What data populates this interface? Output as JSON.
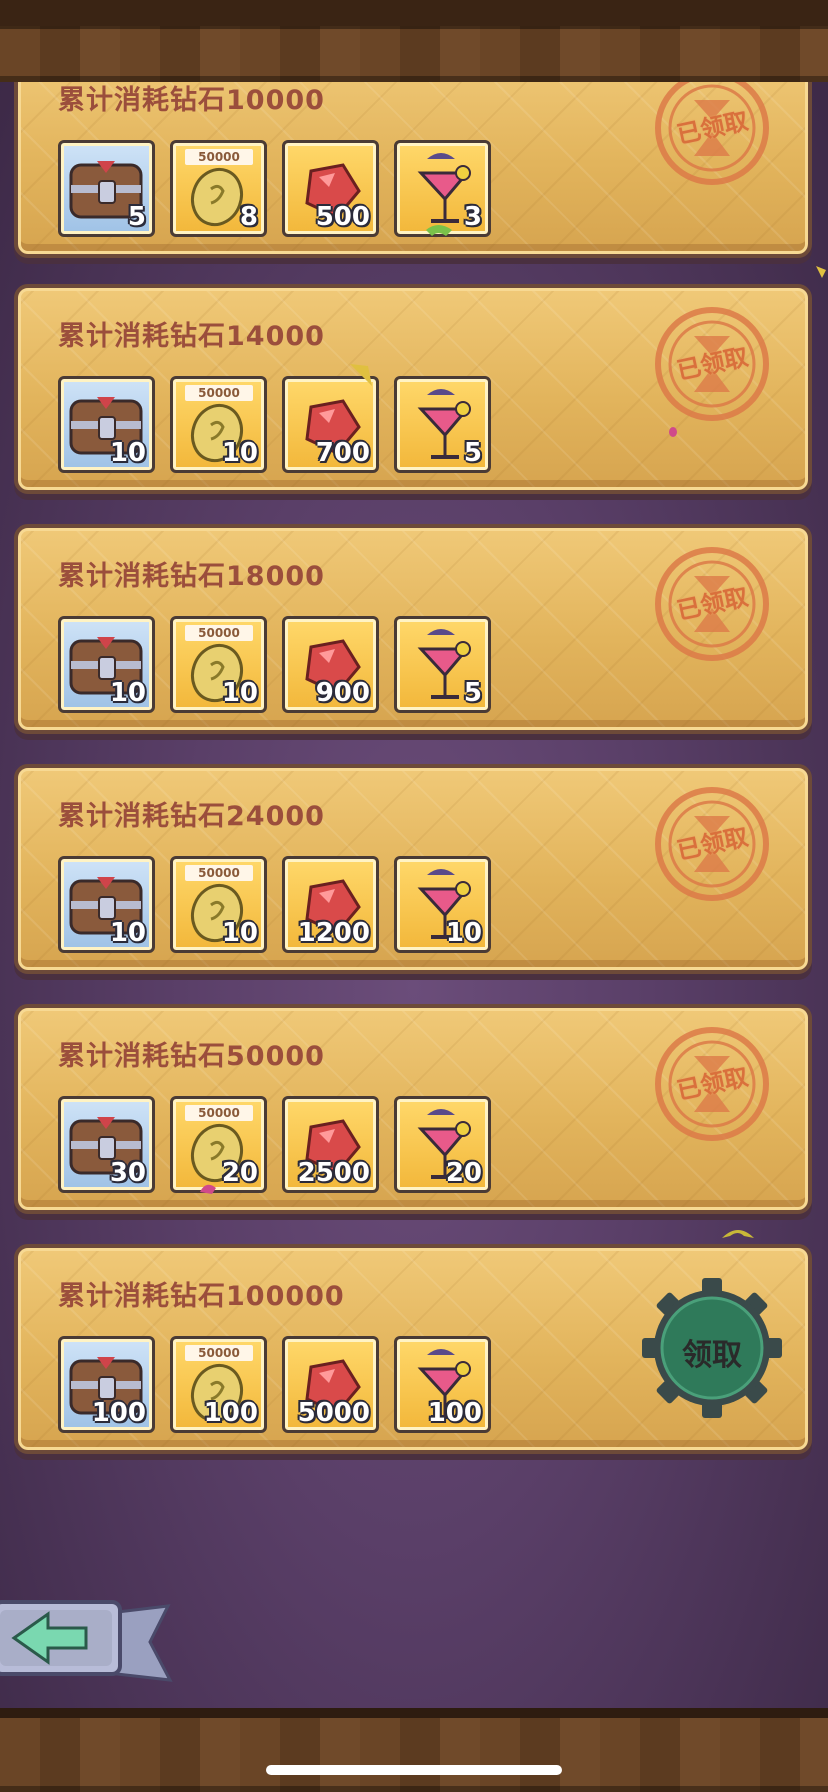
{
  "tiers": [
    {
      "title": "累计消耗钻石10000",
      "rewards": [
        "5",
        "8",
        "500",
        "3"
      ],
      "state": "claimed",
      "stamp": "已领取"
    },
    {
      "title": "累计消耗钻石14000",
      "rewards": [
        "10",
        "10",
        "700",
        "5"
      ],
      "state": "claimed",
      "stamp": "已领取"
    },
    {
      "title": "累计消耗钻石18000",
      "rewards": [
        "10",
        "10",
        "900",
        "5"
      ],
      "state": "claimed",
      "stamp": "已领取"
    },
    {
      "title": "累计消耗钻石24000",
      "rewards": [
        "10",
        "10",
        "1200",
        "10"
      ],
      "state": "claimed",
      "stamp": "已领取"
    },
    {
      "title": "累计消耗钻石50000",
      "rewards": [
        "30",
        "20",
        "2500",
        "20"
      ],
      "state": "claimed",
      "stamp": "已领取"
    },
    {
      "title": "累计消耗钻石100000",
      "rewards": [
        "100",
        "100",
        "5000",
        "100"
      ],
      "state": "claimable",
      "button": "领取"
    }
  ],
  "coin_tag": "50000",
  "icons": {
    "slot1": "treasure-chest-icon",
    "slot2": "gold-coin-icon",
    "slot3": "ruby-gem-icon",
    "slot4": "cocktail-icon",
    "back": "back-arrow-icon"
  },
  "colors": {
    "card": "#e6b660",
    "title": "#9b4e3c",
    "stamp": "#d9703c",
    "claim_button": "#2f7a5a"
  }
}
